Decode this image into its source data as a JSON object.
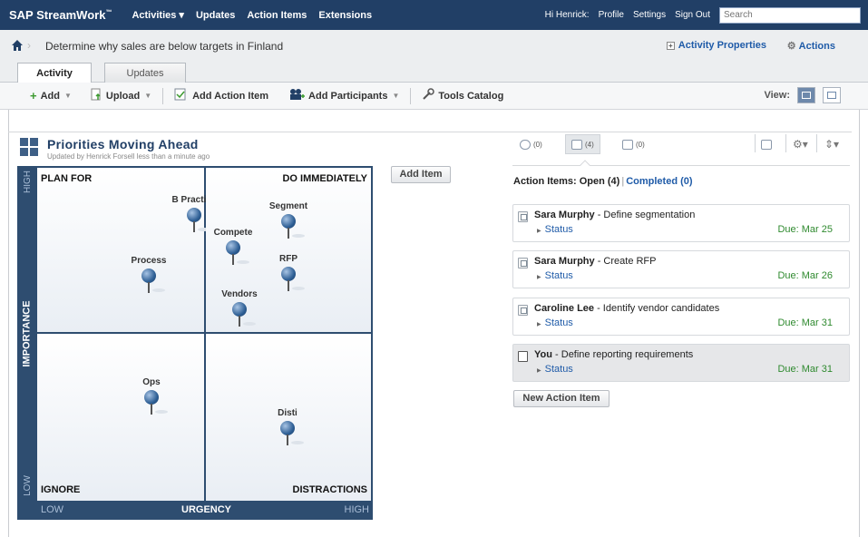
{
  "topnav": {
    "brand": "SAP StreamWork",
    "brand_mark": "™",
    "items": [
      "Activities ▾",
      "Updates",
      "Action Items",
      "Extensions"
    ],
    "greeting": "Hi Henrick:",
    "profile": "Profile",
    "settings": "Settings",
    "signout": "Sign Out",
    "search_placeholder": "Search"
  },
  "header": {
    "title": "Determine why sales are below targets in Finland",
    "activity_properties": "Activity Properties",
    "actions": "Actions"
  },
  "tabs": [
    "Activity",
    "Updates"
  ],
  "toolbar": {
    "add": "Add",
    "upload": "Upload",
    "add_action_item": "Add Action Item",
    "add_participants": "Add Participants",
    "tools_catalog": "Tools Catalog",
    "view": "View:"
  },
  "priorities": {
    "title": "Priorities Moving Ahead",
    "subtitle": "Updated by Henrick Forsell less than a minute ago",
    "y_high": "HIGH",
    "y_low": "LOW",
    "y_label": "IMPORTANCE",
    "x_low": "LOW",
    "x_label": "URGENCY",
    "x_high": "HIGH",
    "quadrants": {
      "plan_for": "PLAN FOR",
      "do_immediately": "DO IMMEDIATELY",
      "ignore": "IGNORE",
      "distractions": "DISTRACTIONS"
    },
    "pins": [
      "B Practice",
      "Segment",
      "Compete",
      "Process",
      "RFP",
      "Vendors",
      "Ops",
      "Disti"
    ],
    "add_item": "Add Item"
  },
  "right_panel": {
    "tab_counts": [
      "(0)",
      "(4)",
      "(0)"
    ],
    "open_label": "Action Items: Open (4)",
    "separator": "|",
    "completed_label": "Completed (0)",
    "items": [
      {
        "owner": "Sara Murphy",
        "task": " - Define segmentation",
        "status": "Status",
        "due": "Due: Mar 25"
      },
      {
        "owner": "Sara Murphy",
        "task": " - Create RFP",
        "status": "Status",
        "due": "Due: Mar 26"
      },
      {
        "owner": "Caroline Lee",
        "task": " - Identify vendor candidates",
        "status": "Status",
        "due": "Due: Mar 31"
      },
      {
        "owner": "You",
        "task": " - Define reporting requirements",
        "status": "Status",
        "due": "Due: Mar 31"
      }
    ],
    "new_action_item": "New Action Item"
  },
  "colors": {
    "nav_bg": "#213f66",
    "link": "#1f5ba8",
    "due_green": "#2f8a2f",
    "matrix_frame": "#2e4d70"
  }
}
